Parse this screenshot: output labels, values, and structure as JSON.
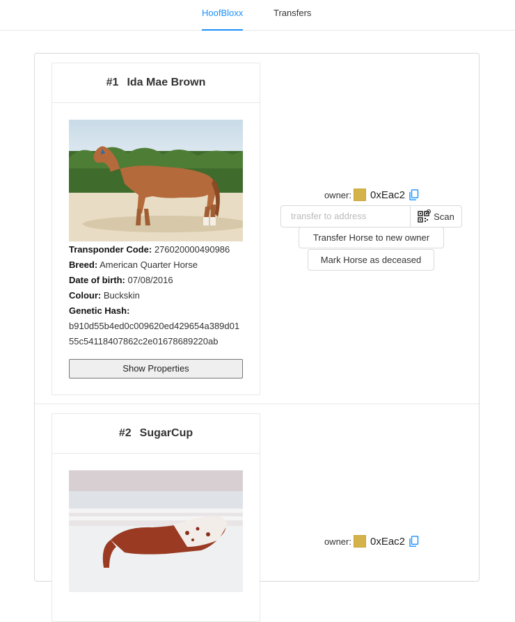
{
  "nav": {
    "tabs": [
      {
        "label": "HoofBloxx",
        "active": true
      },
      {
        "label": "Transfers",
        "active": false
      }
    ]
  },
  "horses": [
    {
      "number": "#1",
      "name": "Ida Mae Brown",
      "image_desc_icon": "horse-photo",
      "fields": {
        "transponder_label": "Transponder Code:",
        "transponder": "276020000490986",
        "breed_label": "Breed:",
        "breed": "American Quarter Horse",
        "dob_label": "Date of birth:",
        "dob": "07/08/2016",
        "colour_label": "Colour:",
        "colour": "Buckskin",
        "hash_label": "Genetic Hash:",
        "hash": "b910d55b4ed0c009620ed429654a389d0155c54118407862c2e01678689220ab"
      },
      "show_properties_label": "Show Properties",
      "owner": {
        "label": "owner:",
        "address": "0xEac2",
        "transfer_placeholder": "transfer to address",
        "scan_label": "Scan",
        "transfer_button": "Transfer Horse to new owner",
        "deceased_button": "Mark Horse as deceased"
      }
    },
    {
      "number": "#2",
      "name": "SugarCup",
      "image_desc_icon": "horse-photo",
      "owner": {
        "label": "owner:",
        "address": "0xEac2"
      }
    }
  ],
  "colors": {
    "accent": "#1890ff",
    "blockie": "#d4b34a"
  }
}
